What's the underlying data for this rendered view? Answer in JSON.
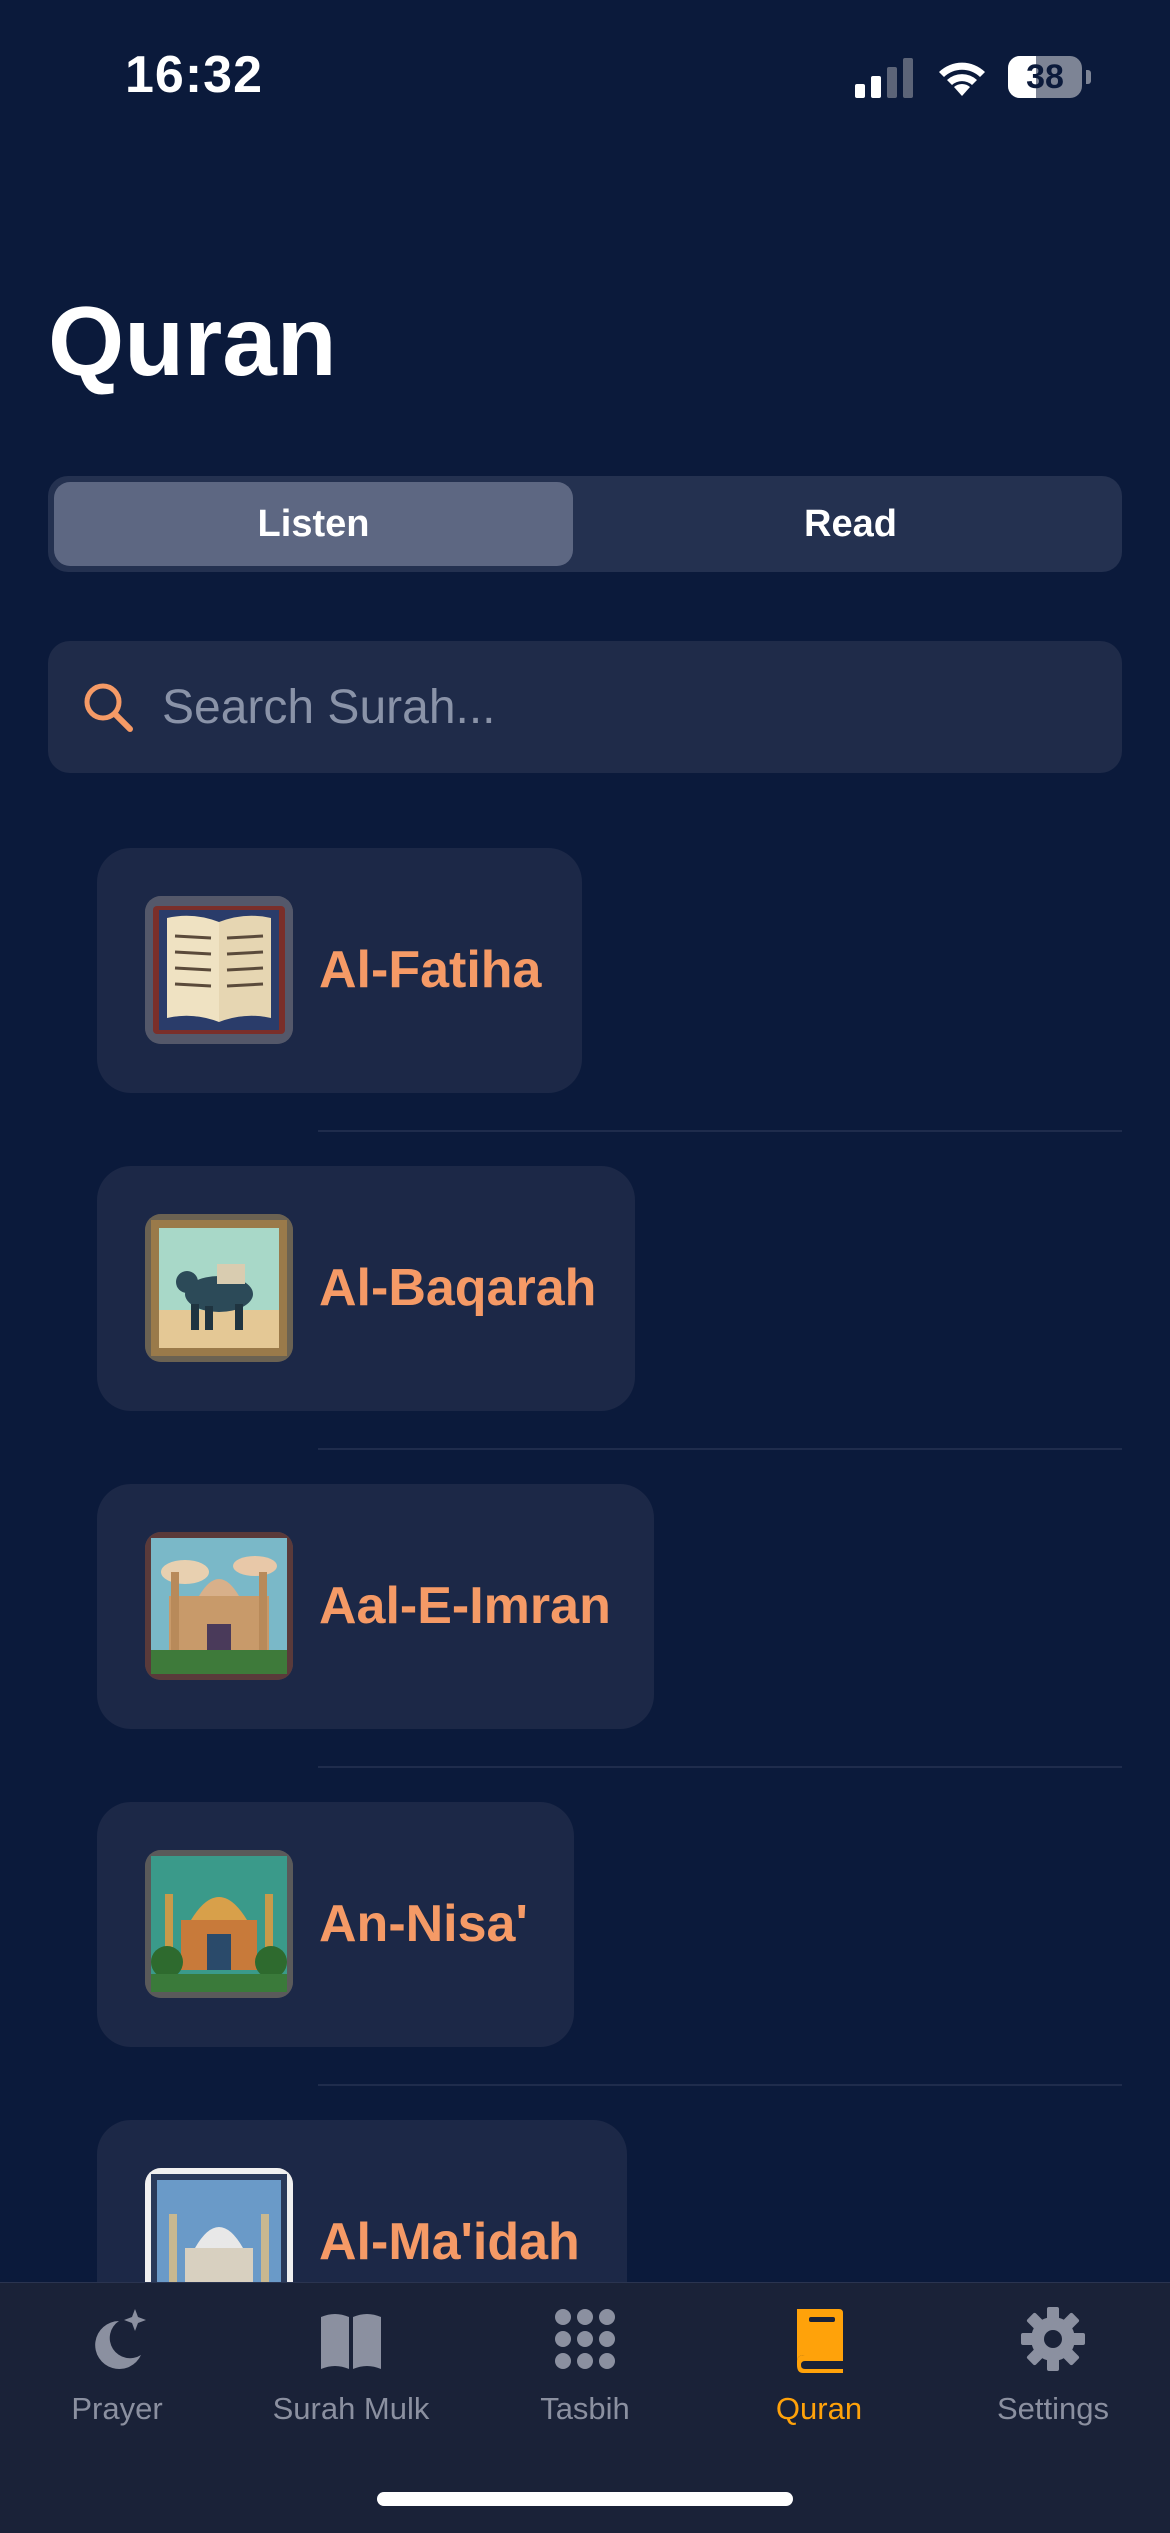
{
  "status_bar": {
    "time": "16:32",
    "battery": "38",
    "battery_level": 0.38
  },
  "page": {
    "title": "Quran"
  },
  "segmented": {
    "options": [
      "Listen",
      "Read"
    ],
    "selected": "Listen"
  },
  "search": {
    "placeholder": "Search Surah...",
    "value": ""
  },
  "surahs": [
    {
      "name": "Al-Fatiha"
    },
    {
      "name": "Al-Baqarah"
    },
    {
      "name": "Aal-E-Imran"
    },
    {
      "name": "An-Nisa'"
    },
    {
      "name": "Al-Ma'idah"
    }
  ],
  "tabbar": {
    "items": [
      {
        "label": "Prayer",
        "icon": "moon-stars-icon"
      },
      {
        "label": "Surah Mulk",
        "icon": "open-book-icon"
      },
      {
        "label": "Tasbih",
        "icon": "dot-grid-icon"
      },
      {
        "label": "Quran",
        "icon": "closed-book-icon"
      },
      {
        "label": "Settings",
        "icon": "gear-icon"
      }
    ],
    "active": "Quran"
  },
  "colors": {
    "background": "#0b1a3b",
    "accent_orange": "#f59a66",
    "tab_active": "#ffa20a",
    "tab_inactive": "#8b90a0"
  }
}
